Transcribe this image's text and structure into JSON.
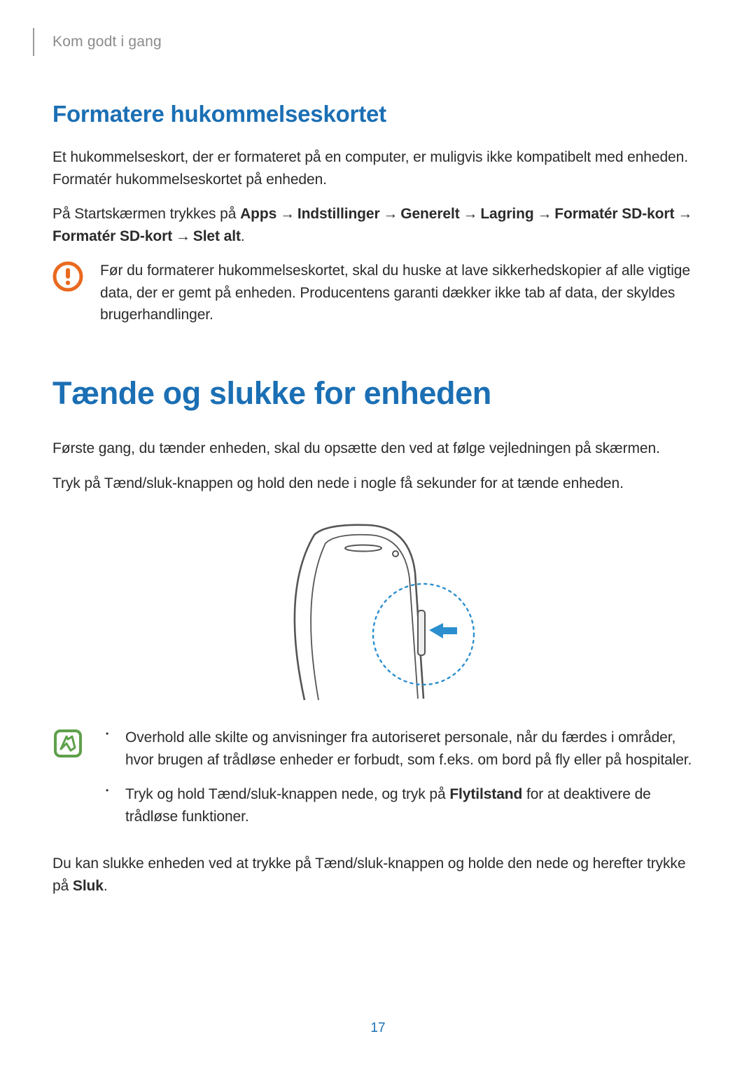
{
  "header": {
    "breadcrumb": "Kom godt i gang"
  },
  "sec1": {
    "title": "Formatere hukommelseskortet",
    "p1": "Et hukommelseskort, der er formateret på en computer, er muligvis ikke kompatibelt med enheden. Formatér hukommelseskortet på enheden.",
    "p2a": "På Startskærmen trykkes på ",
    "p2b_apps": "Apps",
    "p2arrow": " → ",
    "p2c_indst": "Indstillinger",
    "p2d_generelt": "Generelt",
    "p2e_lagring": "Lagring",
    "p2f_format1": "Formatér SD-kort",
    "p2g_format2": "Formatér SD-kort",
    "p2h_slet": "Slet alt",
    "p2end": ".",
    "warn": "Før du formaterer hukommelseskortet, skal du huske at lave sikkerhedskopier af alle vigtige data, der er gemt på enheden. Producentens garanti dækker ikke tab af data, der skyldes brugerhandlinger."
  },
  "sec2": {
    "title": "Tænde og slukke for enheden",
    "p1": "Første gang, du tænder enheden, skal du opsætte den ved at følge vejledningen på skærmen.",
    "p2": "Tryk på Tænd/sluk-knappen og hold den nede i nogle få sekunder for at tænde enheden.",
    "note_bullet1": "Overhold alle skilte og anvisninger fra autoriseret personale, når du færdes i områder, hvor brugen af trådløse enheder er forbudt, som f.eks. om bord på fly eller på hospitaler.",
    "note_bullet2a": "Tryk og hold Tænd/sluk-knappen nede, og tryk på ",
    "note_bullet2b_fly": "Flytilstand",
    "note_bullet2c": " for at deaktivere de trådløse funktioner.",
    "p3a": "Du kan slukke enheden ved at trykke på Tænd/sluk-knappen og holde den nede og herefter trykke på ",
    "p3b_sluk": "Sluk",
    "p3c": "."
  },
  "page_number": "17",
  "colors": {
    "accent": "#1b6fb4",
    "warn_orange": "#e96a1f",
    "note_green": "#5fa04b",
    "arrow_blue": "#2b8fcf"
  }
}
